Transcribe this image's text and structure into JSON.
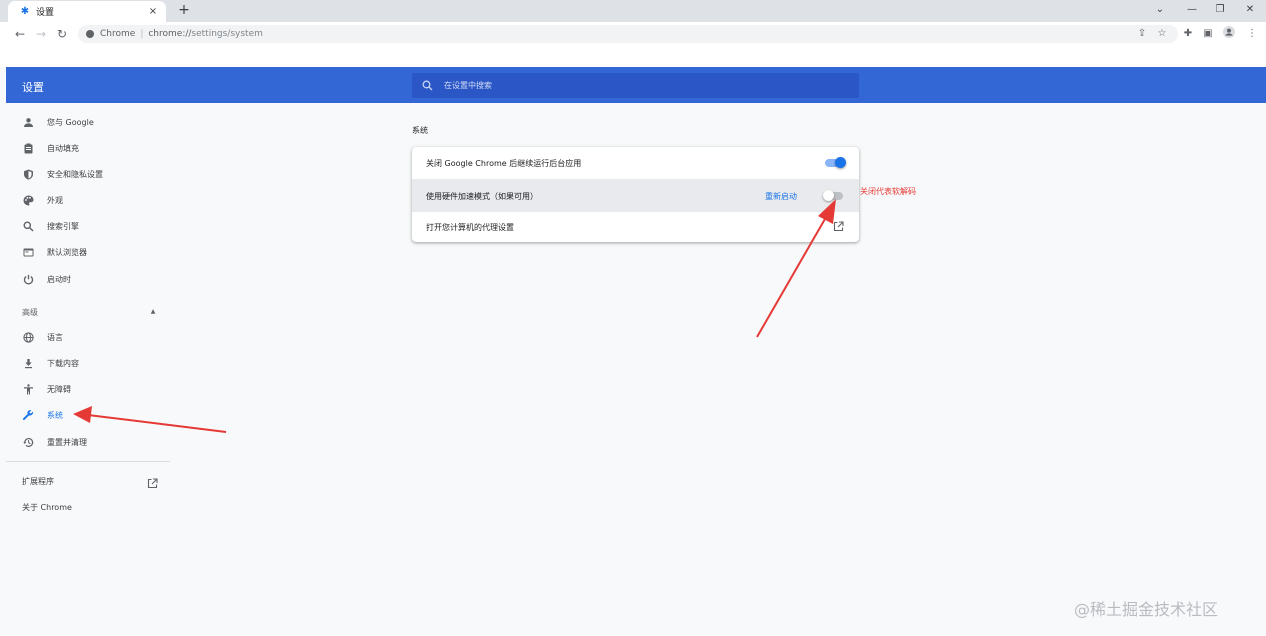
{
  "tab": {
    "title": "设置",
    "favicon_icon": "gear-icon",
    "close": "×"
  },
  "new_tab": "+",
  "window_controls": {
    "menu": "⌄",
    "minimize": "—",
    "restore": "❐",
    "close": "✕"
  },
  "omnibox": {
    "site": "Chrome",
    "separator": "|",
    "url_scheme": "chrome://",
    "url_path": "settings/system"
  },
  "header": {
    "title": "设置",
    "search_placeholder": "在设置中搜索"
  },
  "sidebar": {
    "items": [
      {
        "label": "您与 Google",
        "icon": "person-icon"
      },
      {
        "label": "自动填充",
        "icon": "clipboard-icon"
      },
      {
        "label": "安全和隐私设置",
        "icon": "shield-icon"
      },
      {
        "label": "外观",
        "icon": "palette-icon"
      },
      {
        "label": "搜索引擎",
        "icon": "search-icon"
      },
      {
        "label": "默认浏览器",
        "icon": "browser-icon"
      },
      {
        "label": "启动时",
        "icon": "power-icon"
      }
    ],
    "advanced_label": "高级",
    "advanced_items": [
      {
        "label": "语言",
        "icon": "globe-icon"
      },
      {
        "label": "下载内容",
        "icon": "download-icon"
      },
      {
        "label": "无障碍",
        "icon": "accessibility-icon"
      },
      {
        "label": "系统",
        "icon": "wrench-icon",
        "active": true
      },
      {
        "label": "重置并清理",
        "icon": "history-icon"
      }
    ],
    "extensions_label": "扩展程序",
    "about_label": "关于 Chrome"
  },
  "main": {
    "section_title": "系统",
    "rows": [
      {
        "label": "关闭 Google Chrome 后继续运行后台应用",
        "toggle": true
      },
      {
        "label": "使用硬件加速模式（如果可用）",
        "toggle": false,
        "action": "重新启动"
      },
      {
        "label": "打开您计算机的代理设置",
        "external": true
      }
    ]
  },
  "annotation": "关闭代表软解码",
  "watermark": "@稀土掘金技术社区",
  "colors": {
    "header": "#3367d6",
    "accent": "#1a73e8",
    "annotation": "#e53935"
  }
}
